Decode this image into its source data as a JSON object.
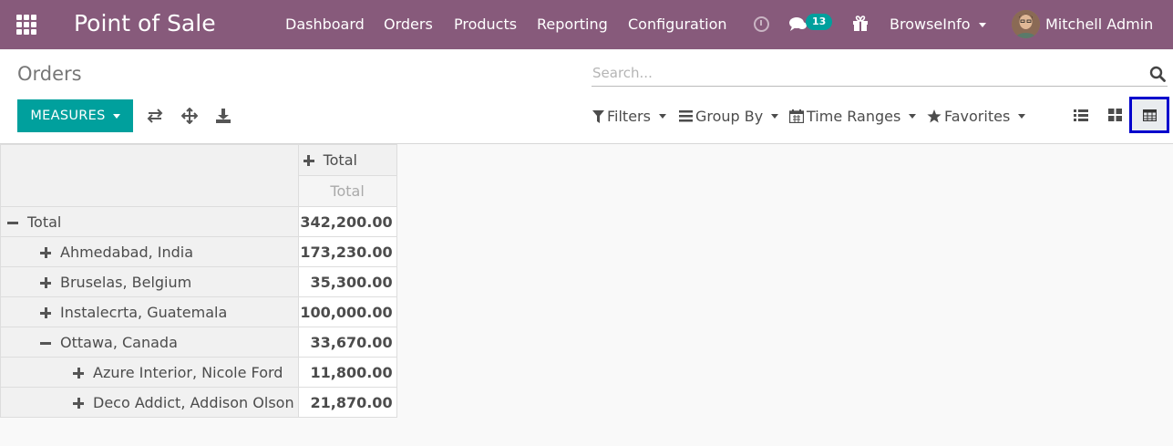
{
  "navbar": {
    "app_title": "Point of Sale",
    "menus": [
      "Dashboard",
      "Orders",
      "Products",
      "Reporting",
      "Configuration"
    ],
    "chat_count": "13",
    "company": "BrowseInfo",
    "user": "Mitchell Admin",
    "bg_color": "#875a7b"
  },
  "control_panel": {
    "breadcrumb": "Orders",
    "search_placeholder": "Search...",
    "measures_label": "MEASURES",
    "filters": {
      "filters_label": "Filters",
      "group_by_label": "Group By",
      "time_ranges_label": "Time Ranges",
      "favorites_label": "Favorites"
    },
    "views": [
      "list-view",
      "kanban-view",
      "pivot-view"
    ],
    "active_view": "pivot-view",
    "accent_color": "#00a09d"
  },
  "pivot": {
    "col_header": "Total",
    "measure_header": "Total",
    "rows": [
      {
        "label": "Total",
        "value": "342,200.00",
        "level": 0,
        "expanded": true
      },
      {
        "label": "Ahmedabad, India",
        "value": "173,230.00",
        "level": 1,
        "expanded": false
      },
      {
        "label": "Bruselas, Belgium",
        "value": "35,300.00",
        "level": 1,
        "expanded": false
      },
      {
        "label": "Instalecrta, Guatemala",
        "value": "100,000.00",
        "level": 1,
        "expanded": false
      },
      {
        "label": "Ottawa, Canada",
        "value": "33,670.00",
        "level": 1,
        "expanded": true
      },
      {
        "label": "Azure Interior, Nicole Ford",
        "value": "11,800.00",
        "level": 2,
        "expanded": false
      },
      {
        "label": "Deco Addict, Addison Olson",
        "value": "21,870.00",
        "level": 2,
        "expanded": false
      }
    ]
  }
}
